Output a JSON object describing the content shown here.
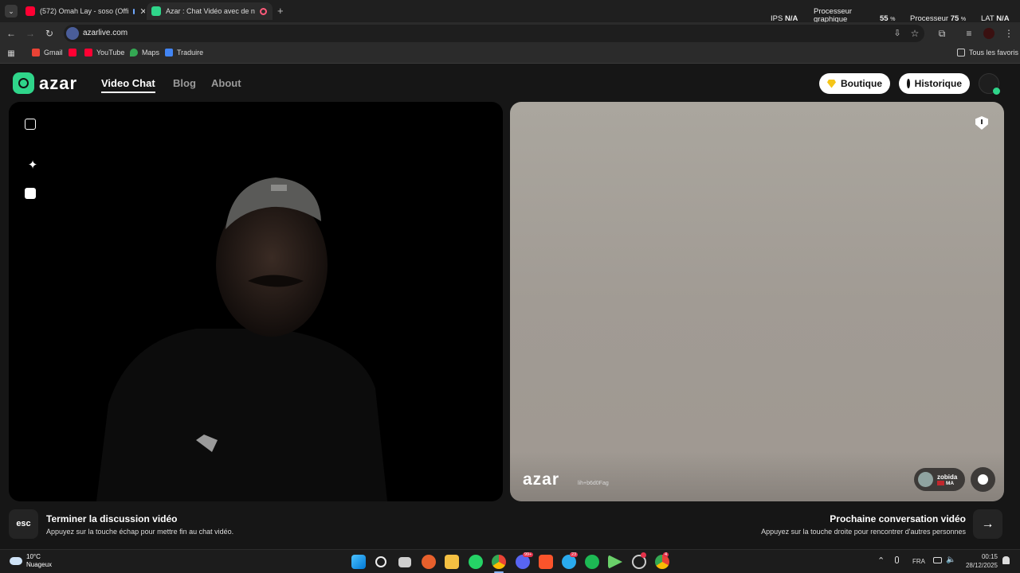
{
  "browser": {
    "tabs": [
      {
        "title": "(572) Omah Lay - soso (Offi",
        "active": false
      },
      {
        "title": "Azar : Chat Vidéo avec de n",
        "active": true
      }
    ],
    "new_tab": "+",
    "url": "azarlive.com",
    "bookmarks": [
      "Gmail",
      "YouTube",
      "Maps",
      "Traduire"
    ],
    "all_bookmarks": "Tous les favoris"
  },
  "overlay": {
    "ips_label": "IPS",
    "ips_value": "N/A",
    "gpu_label_1": "Processeur",
    "gpu_label_2": "graphique",
    "gpu_value": "55",
    "gpu_unit": "%",
    "cpu_label": "Processeur",
    "cpu_value": "75",
    "cpu_unit": "%",
    "lat_label": "LAT",
    "lat_value": "N/A"
  },
  "site": {
    "logo": "azar",
    "nav": [
      "Video Chat",
      "Blog",
      "About"
    ],
    "boutique": "Boutique",
    "historique": "Historique",
    "remote": {
      "watermark": "azar",
      "watermark_id": "lih+b6d0Fag",
      "user_name": "zobida",
      "user_country": "MA"
    },
    "footer": {
      "esc_key": "esc",
      "end_title": "Terminer la discussion vidéo",
      "end_sub": "Appuyez sur la touche échap pour mettre fin au chat vidéo.",
      "next_title": "Prochaine conversation vidéo",
      "next_sub": "Appuyez sur la touche droite pour rencontrer d'autres personnes"
    }
  },
  "taskbar": {
    "weather_temp": "10°C",
    "weather_desc": "Nuageux",
    "lang": "FRA",
    "time": "00:15",
    "date": "28/12/2025",
    "badges": [
      "99+",
      "23",
      "4"
    ]
  },
  "colors": {
    "azar_green": "#2fd58a",
    "youtube_red": "#ff0033",
    "page_bg": "#161616"
  }
}
